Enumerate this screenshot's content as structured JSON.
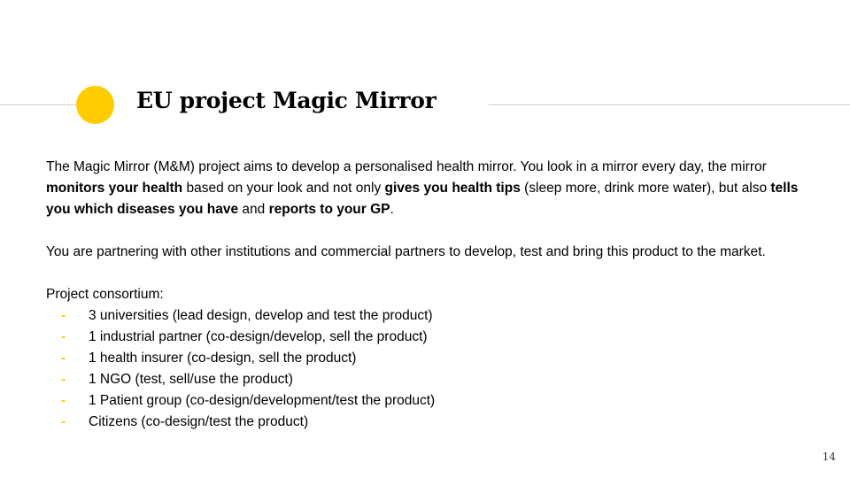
{
  "title": "EU project Magic Mirror",
  "paragraph1": {
    "s1": "The Magic Mirror (M&M) project aims to develop a personalised health mirror. You look in a mirror every day, the mirror ",
    "b1": "monitors your health",
    "s2": " based on your look and not only ",
    "b2": "gives you health tips",
    "s3": " (sleep more, drink more water), but also ",
    "b3": "tells you which diseases you have",
    "s4": " and ",
    "b4": "reports to your GP",
    "s5": "."
  },
  "paragraph2": "You are partnering with other institutions and commercial partners to develop, test and bring this product to the market.",
  "consortium": {
    "heading": "Project consortium:",
    "bullet": "-",
    "items": [
      "3 universities (lead design, develop and test the product)",
      "1 industrial partner (co-design/develop, sell the product)",
      "1 health insurer (co-design, sell the product)",
      "1 NGO (test, sell/use the product)",
      "1 Patient group (co-design/development/test the product)",
      "Citizens (co-design/test the product)"
    ]
  },
  "page_number": "14",
  "colors": {
    "accent": "#ffcc00",
    "rule": "#cfcfcf",
    "text": "#000000"
  }
}
